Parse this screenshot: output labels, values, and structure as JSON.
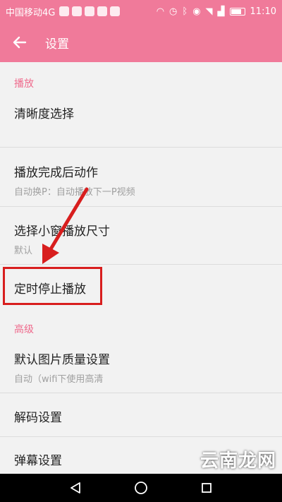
{
  "status_bar": {
    "carrier": "中国移动4G",
    "time": "11:10"
  },
  "toolbar": {
    "title": "设置",
    "back_icon": "arrow-left-icon"
  },
  "sections": {
    "playback": {
      "header": "播放"
    },
    "advanced": {
      "header": "高级"
    }
  },
  "items": {
    "resolution": {
      "title": "清晰度选择"
    },
    "after_play": {
      "title": "播放完成后动作",
      "subtitle": "自动换P：自动播放下一P视频"
    },
    "mini_window": {
      "title": "选择小窗播放尺寸",
      "subtitle": "默认"
    },
    "timer_stop": {
      "title": "定时停止播放"
    },
    "image_quality": {
      "title": "默认图片质量设置",
      "subtitle": "自动（wifi下使用高清"
    },
    "decode": {
      "title": "解码设置"
    },
    "danmaku": {
      "title": "弹幕设置"
    }
  },
  "watermark": "云南龙网",
  "colors": {
    "accent": "#f07a9a",
    "section_header": "#ef6b8d",
    "highlight": "#d81e1e",
    "arrow": "#d81e1e"
  },
  "nav_icons": [
    "back-triangle-icon",
    "home-circle-icon",
    "recents-square-icon"
  ]
}
